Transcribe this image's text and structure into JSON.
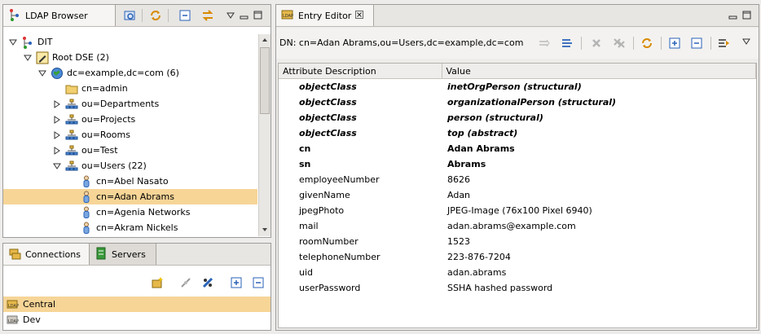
{
  "ldap_browser": {
    "tab_title": "LDAP Browser",
    "tree": [
      {
        "label": "DIT",
        "indent": 0,
        "twisty": "open",
        "icon": "dit-icon"
      },
      {
        "label": "Root DSE (2)",
        "indent": 1,
        "twisty": "open",
        "icon": "root-dse-icon"
      },
      {
        "label": "dc=example,dc=com (6)",
        "indent": 2,
        "twisty": "open",
        "icon": "domain-globe-icon"
      },
      {
        "label": "cn=admin",
        "indent": 3,
        "twisty": "none",
        "icon": "folder-icon"
      },
      {
        "label": "ou=Departments",
        "indent": 3,
        "twisty": "closed",
        "icon": "org-unit-icon"
      },
      {
        "label": "ou=Projects",
        "indent": 3,
        "twisty": "closed",
        "icon": "org-unit-icon"
      },
      {
        "label": "ou=Rooms",
        "indent": 3,
        "twisty": "closed",
        "icon": "org-unit-icon"
      },
      {
        "label": "ou=Test",
        "indent": 3,
        "twisty": "closed",
        "icon": "org-unit-icon"
      },
      {
        "label": "ou=Users (22)",
        "indent": 3,
        "twisty": "open",
        "icon": "org-unit-icon"
      },
      {
        "label": "cn=Abel Nasato",
        "indent": 4,
        "twisty": "none",
        "icon": "person-icon"
      },
      {
        "label": "cn=Adan Abrams",
        "indent": 4,
        "twisty": "none",
        "icon": "person-icon",
        "selected": true
      },
      {
        "label": "cn=Agenia Networks",
        "indent": 4,
        "twisty": "none",
        "icon": "person-icon"
      },
      {
        "label": "cn=Akram Nickels",
        "indent": 4,
        "twisty": "none",
        "icon": "person-icon"
      }
    ]
  },
  "connections": {
    "tab_connections": "Connections",
    "tab_servers": "Servers",
    "items": [
      {
        "label": "Central",
        "selected": true
      },
      {
        "label": "Dev",
        "selected": false
      }
    ]
  },
  "entry_editor": {
    "tab_title": "Entry Editor",
    "dn": "DN: cn=Adan Abrams,ou=Users,dc=example,dc=com",
    "col_attribute": "Attribute Description",
    "col_value": "Value",
    "rows": [
      {
        "attr": "objectClass",
        "value": "inetOrgPerson (structural)",
        "style": "bi"
      },
      {
        "attr": "objectClass",
        "value": "organizationalPerson (structural)",
        "style": "bi"
      },
      {
        "attr": "objectClass",
        "value": "person (structural)",
        "style": "bi"
      },
      {
        "attr": "objectClass",
        "value": "top (abstract)",
        "style": "bi"
      },
      {
        "attr": "cn",
        "value": "Adan Abrams",
        "style": "b"
      },
      {
        "attr": "sn",
        "value": "Abrams",
        "style": "b"
      },
      {
        "attr": "employeeNumber",
        "value": "8626",
        "style": ""
      },
      {
        "attr": "givenName",
        "value": "Adan",
        "style": ""
      },
      {
        "attr": "jpegPhoto",
        "value": "JPEG-Image (76x100 Pixel 6940)",
        "style": ""
      },
      {
        "attr": "mail",
        "value": "adan.abrams@example.com",
        "style": ""
      },
      {
        "attr": "roomNumber",
        "value": "1523",
        "style": ""
      },
      {
        "attr": "telephoneNumber",
        "value": "223-876-7204",
        "style": ""
      },
      {
        "attr": "uid",
        "value": "adan.abrams",
        "style": ""
      },
      {
        "attr": "userPassword",
        "value": "SSHA hashed password",
        "style": ""
      }
    ]
  },
  "colors": {
    "selection": "#f6d597",
    "accent_blue": "#2a62b8",
    "folder_yellow": "#e6b84a"
  }
}
